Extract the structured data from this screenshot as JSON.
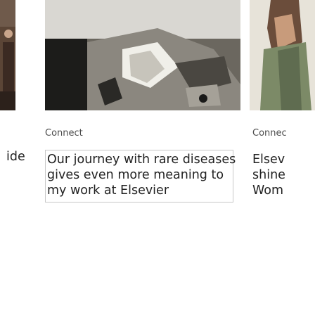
{
  "cards": [
    {
      "category": "",
      "headline": "ide"
    },
    {
      "category": "Connect",
      "headline_lines": [
        "Our journey with rare diseases",
        "gives even more meaning to",
        "my work at Elsevier"
      ]
    },
    {
      "category": "Connec",
      "headline_lines": [
        "Elsev",
        "shine",
        "Wom"
      ]
    }
  ],
  "colors": {
    "background": "#ffffff",
    "text": "#222222",
    "category": "#4a4a4a",
    "focus_border": "#c7c7c7"
  }
}
